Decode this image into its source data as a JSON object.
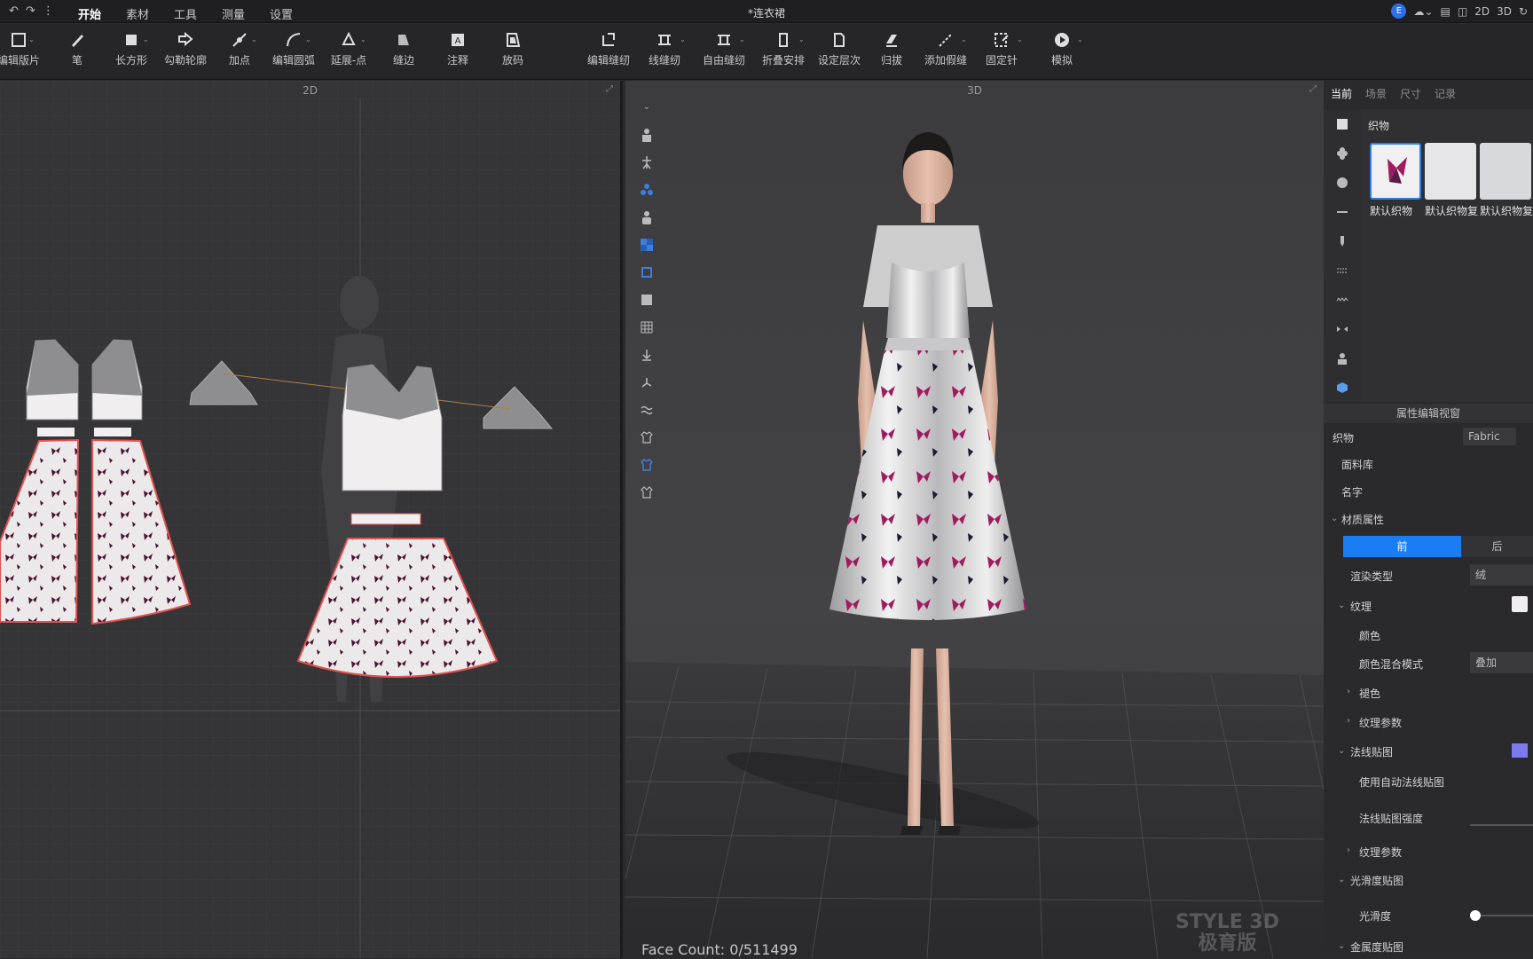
{
  "title_bar": {
    "doc_title": "*连衣裙",
    "avatar_letter": "E",
    "view_modes": [
      "2D",
      "3D"
    ]
  },
  "menu": [
    "开始",
    "素材",
    "工具",
    "测量",
    "设置"
  ],
  "toolbar_left": [
    "编辑版片",
    "笔",
    "长方形",
    "勾勒轮廓",
    "加点",
    "编辑圆弧",
    "延展-点",
    "缝边",
    "注释",
    "放码"
  ],
  "toolbar_right": [
    "编辑缝纫",
    "线缝纫",
    "自由缝纫",
    "折叠安排",
    "设定层次",
    "归拔",
    "添加假缝",
    "固定针",
    "模拟"
  ],
  "panel_2d": {
    "title": "2D"
  },
  "panel_3d": {
    "title": "3D",
    "face_count": "Face Count: 0/511499",
    "watermark_line1": "STYLE 3D",
    "watermark_line2": "极育版"
  },
  "right_panel": {
    "tabs": [
      "当前",
      "场景",
      "尺寸",
      "记录"
    ],
    "section": "织物",
    "fabrics": [
      "默认织物",
      "默认织物复",
      "默认织物复"
    ],
    "prop_header": "属性编辑视窗",
    "prop_fabric_label": "织物",
    "fabric_badge": "Fabric",
    "fabric_library": "面料库",
    "name": "名字",
    "material": "材质属性",
    "front": "前",
    "back": "后",
    "render_type": "渲染类型",
    "render_type_value": "绒",
    "texture": "纹理",
    "color": "颜色",
    "blend_mode": "颜色混合模式",
    "blend_mode_value": "叠加",
    "dye": "褪色",
    "texture_params": "纹理参数",
    "normal_map": "法线贴图",
    "auto_normal": "使用自动法线贴图",
    "normal_strength": "法线贴图强度",
    "texture_params2": "纹理参数",
    "gloss_map": "光滑度贴图",
    "gloss": "光滑度",
    "metal_map": "金属度贴图"
  },
  "colors": {
    "accent": "#1a7df2",
    "normal_swatch": "#7b7bf0",
    "print": "#8a1a5a"
  }
}
